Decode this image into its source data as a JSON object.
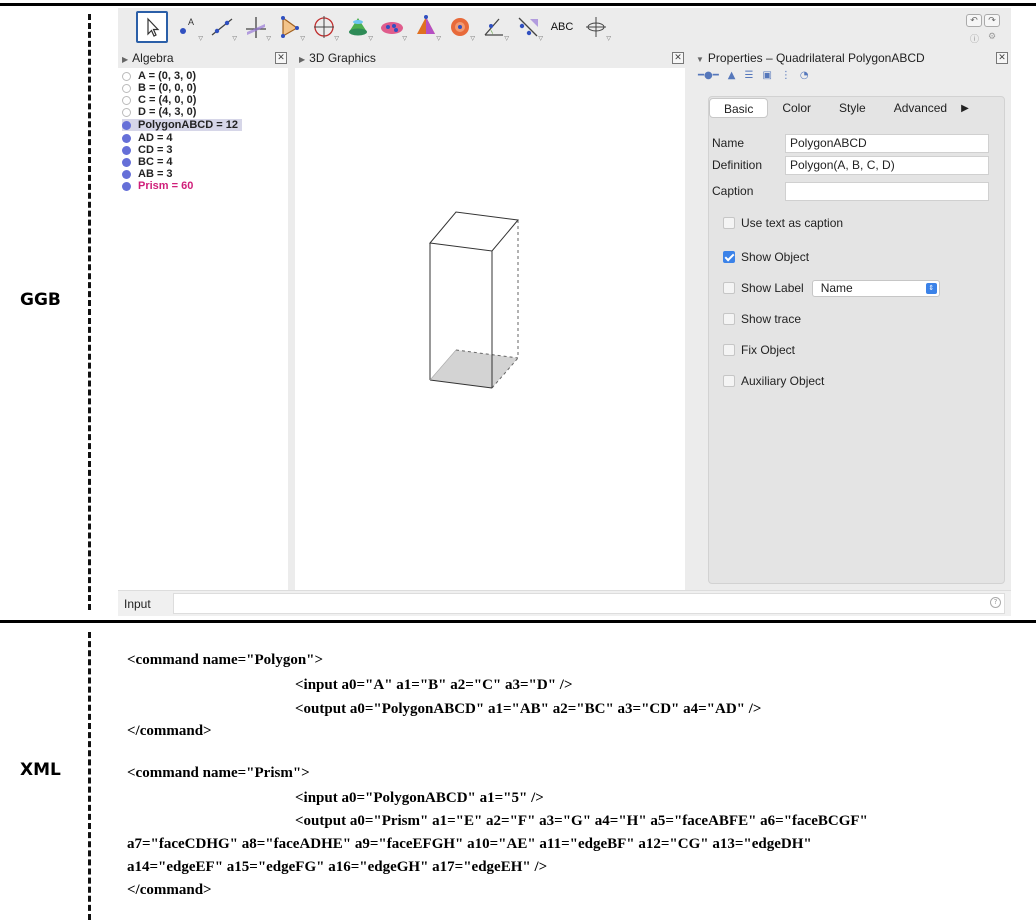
{
  "labels": {
    "ggb": "GGB",
    "xml": "XML"
  },
  "ggb": {
    "toolbar": {
      "tools": [
        {
          "icon": "move-arrow-icon"
        },
        {
          "icon": "point-icon"
        },
        {
          "icon": "line-icon"
        },
        {
          "icon": "perpendicular-icon"
        },
        {
          "icon": "polygon-icon"
        },
        {
          "icon": "circle-axis-icon"
        },
        {
          "icon": "intersect-surfaces-icon"
        },
        {
          "icon": "plane-icon"
        },
        {
          "icon": "pyramid-icon"
        },
        {
          "icon": "sphere-icon"
        },
        {
          "icon": "angle-icon"
        },
        {
          "icon": "reflect-icon"
        },
        {
          "icon": "text-tool-icon",
          "label": "ABC"
        },
        {
          "icon": "rotate-view-icon"
        }
      ]
    },
    "algebra": {
      "title": "Algebra",
      "items": [
        {
          "text": "A = (0, 3, 0)",
          "type": "hollow"
        },
        {
          "text": "B = (0, 0, 0)",
          "type": "hollow"
        },
        {
          "text": "C = (4, 0, 0)",
          "type": "hollow"
        },
        {
          "text": "D = (4, 3, 0)",
          "type": "hollow"
        },
        {
          "text": "PolygonABCD = 12",
          "type": "selected"
        },
        {
          "text": "AD = 4",
          "type": "filled"
        },
        {
          "text": "CD = 3",
          "type": "filled"
        },
        {
          "text": "BC = 4",
          "type": "filled"
        },
        {
          "text": "AB = 3",
          "type": "filled"
        },
        {
          "text": "Prism = 60",
          "type": "prism"
        }
      ]
    },
    "graphics": {
      "title": "3D Graphics"
    },
    "properties": {
      "title": "Properties – Quadrilateral PolygonABCD",
      "tabs": [
        "Basic",
        "Color",
        "Style",
        "Advanced"
      ],
      "active_tab": "Basic",
      "name_label": "Name",
      "name_value": "PolygonABCD",
      "definition_label": "Definition",
      "definition_value": "Polygon(A, B, C, D)",
      "caption_label": "Caption",
      "caption_value": "",
      "use_text_as_caption": "Use text as caption",
      "show_object": "Show Object",
      "show_label": "Show Label",
      "show_label_option": "Name",
      "show_trace": "Show trace",
      "fix_object": "Fix Object",
      "auxiliary_object": "Auxiliary Object"
    },
    "input": {
      "label": "Input",
      "value": ""
    },
    "colors": {
      "accent": "#2b5fa8",
      "point": "#6670d8",
      "prism": "#d01f7a",
      "checkbox": "#3b82e8"
    }
  },
  "xml": {
    "lines": [
      "<command name=\"Polygon\">",
      "<input a0=\"A\" a1=\"B\" a2=\"C\" a3=\"D\" />",
      "<output a0=\"PolygonABCD\" a1=\"AB\" a2=\"BC\" a3=\"CD\" a4=\"AD\" />",
      "</command>",
      "<command name=\"Prism\">",
      "<input a0=\"PolygonABCD\" a1=\"5\" />",
      "<output a0=\"Prism\" a1=\"E\" a2=\"F\" a3=\"G\" a4=\"H\" a5=\"faceABFE\" a6=\"faceBCGF\"",
      "a7=\"faceCDHG\" a8=\"faceADHE\" a9=\"faceEFGH\" a10=\"AE\" a11=\"edgeBF\" a12=\"CG\" a13=\"edgeDH\"",
      "a14=\"edgeEF\" a15=\"edgeFG\" a16=\"edgeGH\" a17=\"edgeEH\" />",
      "</command>"
    ]
  }
}
